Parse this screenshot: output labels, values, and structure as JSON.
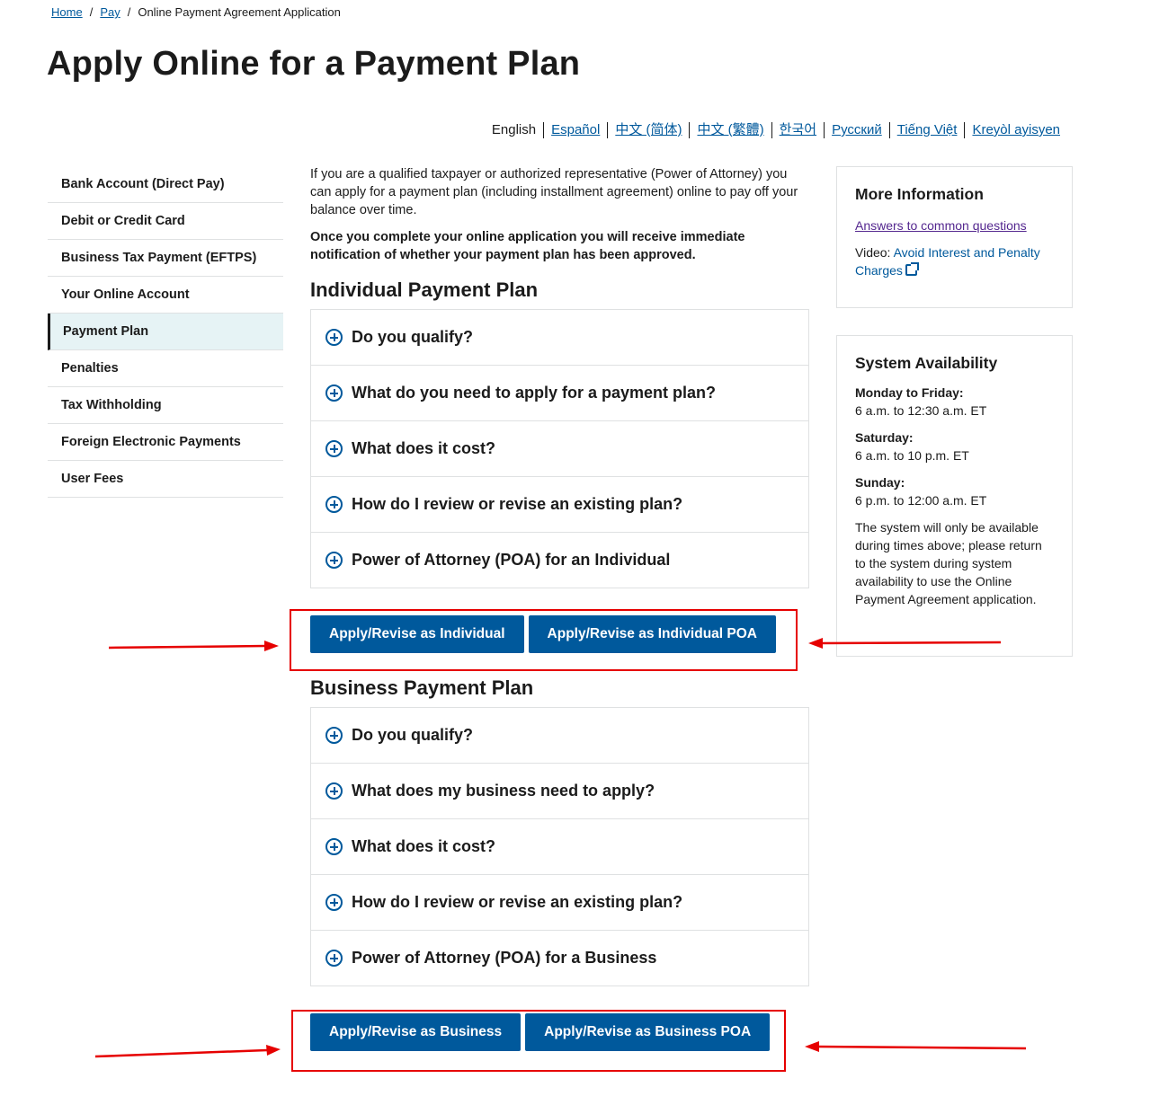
{
  "breadcrumb": {
    "home": "Home",
    "pay": "Pay",
    "current": "Online Payment Agreement Application",
    "sep": "/"
  },
  "page_title": "Apply Online for a Payment Plan",
  "languages": [
    "English",
    "Español",
    "中文 (简体)",
    "中文 (繁體)",
    "한국어",
    "Русский",
    "Tiếng Việt",
    "Kreyòl ayisyen"
  ],
  "sidenav": [
    "Bank Account (Direct Pay)",
    "Debit or Credit Card",
    "Business Tax Payment (EFTPS)",
    "Your Online Account",
    "Payment Plan",
    "Penalties",
    "Tax Withholding",
    "Foreign Electronic Payments",
    "User Fees"
  ],
  "intro": {
    "text": "If you are a qualified taxpayer or authorized representative (Power of Attorney) you can apply for a payment plan (including installment agreement) online to pay off your balance over time.",
    "bold": "Once you complete your online application you will receive immediate notification of whether your payment plan has been approved."
  },
  "individual": {
    "heading": "Individual Payment Plan",
    "items": [
      "Do you qualify?",
      "What do you need to apply for a payment plan?",
      "What does it cost?",
      "How do I review or revise an existing plan?",
      "Power of Attorney (POA) for an Individual"
    ],
    "btn1": "Apply/Revise as Individual",
    "btn2": "Apply/Revise as Individual POA"
  },
  "business": {
    "heading": "Business Payment Plan",
    "items": [
      "Do you qualify?",
      "What does my business need to apply?",
      "What does it cost?",
      "How do I review or revise an existing plan?",
      "Power of Attorney (POA) for a Business"
    ],
    "btn1": "Apply/Revise as Business",
    "btn2": "Apply/Revise as Business POA"
  },
  "more_info": {
    "title": "More Information",
    "link1": "Answers to common questions",
    "video_prefix": "Video: ",
    "video_link": "Avoid Interest and Penalty Charges"
  },
  "availability": {
    "title": "System Availability",
    "weekday_label": "Monday to Friday:",
    "weekday_hours": "6 a.m. to 12:30 a.m. ET",
    "saturday_label": "Saturday:",
    "saturday_hours": "6 a.m. to 10 p.m. ET",
    "sunday_label": "Sunday:",
    "sunday_hours": "6 p.m. to 12:00 a.m. ET",
    "note": "The system will only be available during times above; please return to the system during system availability to use the Online Payment Agreement application."
  },
  "colors": {
    "primary": "#00599c",
    "annotation": "#e60000",
    "active_nav_bg": "#e6f3f5",
    "visited_link": "#54278f"
  }
}
